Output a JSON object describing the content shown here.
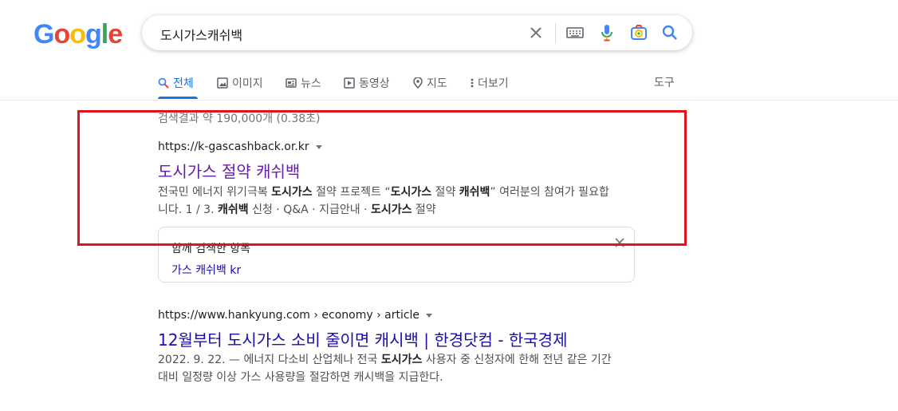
{
  "logo": {
    "text": "Google"
  },
  "search": {
    "query": "도시가스캐쉬백"
  },
  "tabs": [
    {
      "label": "전체"
    },
    {
      "label": "이미지"
    },
    {
      "label": "뉴스"
    },
    {
      "label": "동영상"
    },
    {
      "label": "지도"
    },
    {
      "label": "더보기"
    }
  ],
  "tools_label": "도구",
  "stats": "검색결과 약 190,000개 (0.38초)",
  "results": [
    {
      "url": "https://k-gascashback.or.kr",
      "title": "도시가스 절약 캐쉬백",
      "snippet_line1": [
        "전국민 에너지 위기극복 ",
        "도시가스",
        " 절약 프로젝트 “",
        "도시가스",
        " 절약 ",
        "캐쉬백",
        "” 여러분의 참여가 필요합"
      ],
      "snippet_line2": [
        "니다. 1 / 3. ",
        "캐쉬백",
        " 신청 · Q&A · 지급안내 · ",
        "도시가스",
        " 절약"
      ]
    },
    {
      "url": "https://www.hankyung.com › economy › article",
      "title": "12월부터 도시가스 소비 줄이면 캐시백 | 한경닷컴 - 한국경제",
      "snippet_line1": [
        "2022. 9. 22. — 에너지 다소비 산업체나 전국 ",
        "도시가스",
        " 사용자 중 신청자에 한해 전년 같은 기간"
      ],
      "snippet_line2": [
        "대비 일정량 이상 가스 사용량을 절감하면 캐시백을 지급한다."
      ]
    }
  ],
  "related": {
    "title": "함께 검색한 항목",
    "item": "가스 캐쉬백 kr"
  },
  "colors": {
    "accent": "#1a73e8",
    "highlight_box": "#e3131b",
    "visited_link": "#681da8",
    "link": "#1a0dab"
  }
}
